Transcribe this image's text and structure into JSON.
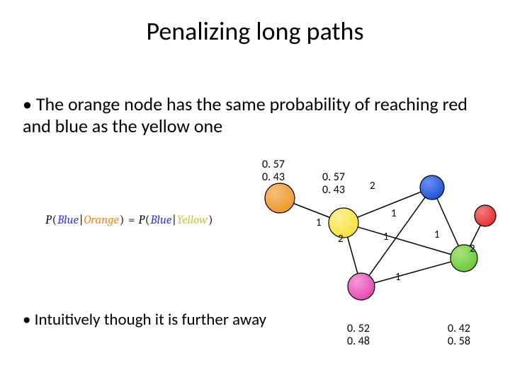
{
  "title": "Penalizing long paths",
  "bullets": {
    "b1": "The orange node has the same probability of reaching red and blue as the yellow one",
    "b2": "Intuitively though it is further away"
  },
  "formula": {
    "pref": "P",
    "open": "(",
    "blue": "Blue",
    "sep": "|",
    "orange": "Orange",
    "close": ")",
    "eq": " = ",
    "yellow": "Yellow"
  },
  "probs": {
    "orange_top": "0. 57",
    "orange_bot": "0. 43",
    "yellow_top": "0. 57",
    "yellow_bot": "0. 43",
    "magenta_top": "0. 52",
    "magenta_bot": "0. 48",
    "green_top": "0. 42",
    "green_bot": "0. 58"
  },
  "edges": {
    "e_yb": "2",
    "e_yg": "1",
    "e_oy": "1",
    "e_yp": "2",
    "e_bg": "1",
    "e_pb": "1",
    "e_pg": "1",
    "e_gr": "2"
  },
  "nodes": {
    "orange": {
      "color": "#ef9a2f",
      "color2": "#f6be7a"
    },
    "yellow": {
      "color": "#f7e33b",
      "color2": "#fbf199"
    },
    "blue": {
      "color": "#2457d6",
      "color2": "#6a8ff0"
    },
    "magenta": {
      "color": "#e74bb2",
      "color2": "#f59ad8"
    },
    "green": {
      "color": "#6fca3a",
      "color2": "#a7e47d"
    },
    "red": {
      "color": "#e43030",
      "color2": "#f47f7f"
    }
  }
}
